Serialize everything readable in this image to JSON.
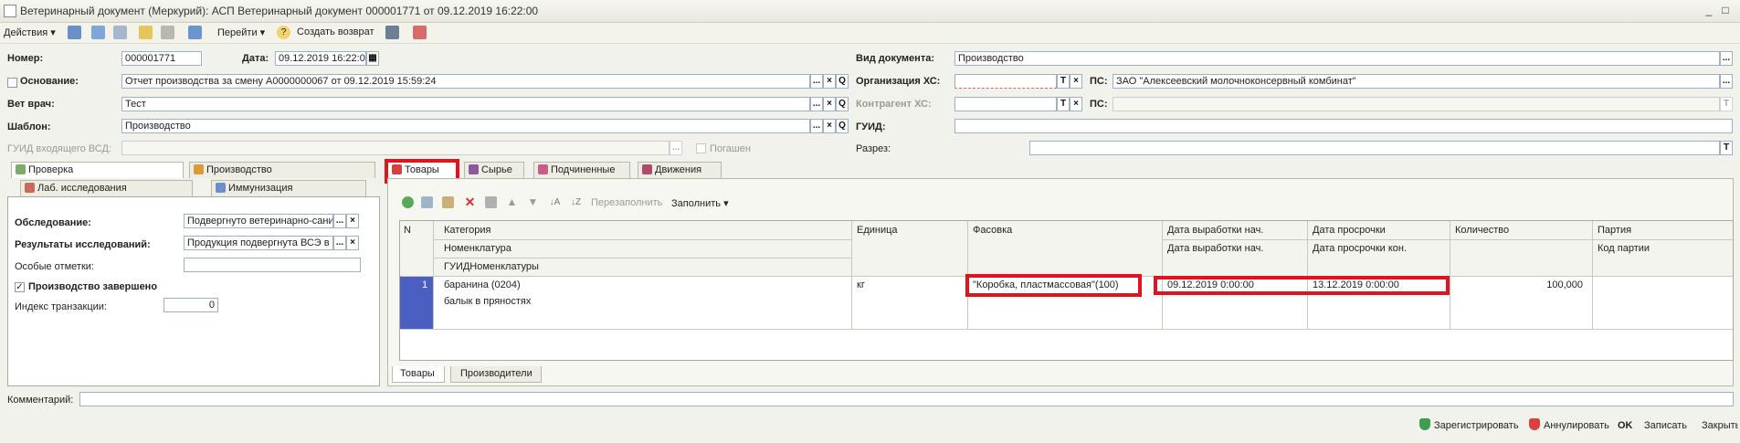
{
  "window": {
    "title": "Ветеринарный документ (Меркурий): АСП Ветеринарный документ 000001771 от 09.12.2019 16:22:00"
  },
  "toolbar": {
    "actions": "Действия",
    "go": "Перейти",
    "create_return": "Создать возврат"
  },
  "header": {
    "number_label": "Номер:",
    "number": "000001771",
    "date_label": "Дата:",
    "date": "09.12.2019 16:22:0",
    "basis_label": "Основание:",
    "basis": "Отчет производства за смену А0000000067 от 09.12.2019 15:59:24",
    "vet_label": "Вет врач:",
    "vet": "Тест",
    "template_label": "Шаблон:",
    "template": "Производство",
    "guid_in_label": "ГУИД входящего ВСД:",
    "repaid_label": "Погашен",
    "doctype_label": "Вид документа:",
    "doctype": "Производство",
    "org_label": "Организация ХС:",
    "org": "",
    "ps_label": "ПС:",
    "ps": "ЗАО \"Алексеевский молочноконсервный комбинат\"",
    "contractor_label": "Контрагент ХС:",
    "ps2_label": "ПС:",
    "guid_label": "ГУИД:",
    "cut_label": "Разрез:",
    "t_btn": "T",
    "x_btn": "×",
    "dots_btn": "...",
    "q_btn": "Q"
  },
  "left_tabs": {
    "check": "Проверка",
    "production": "Производство",
    "lab": "Лаб. исследования",
    "immun": "Иммунизация"
  },
  "left_panel": {
    "survey_label": "Обследование:",
    "survey": "Подвергнуто ветеринарно-сани",
    "results_label": "Результаты исследований:",
    "results": "Продукция подвергнута ВСЭ в г",
    "special_label": "Особые отметки:",
    "done_label": "Производство завершено",
    "index_label": "Индекс транзакции:",
    "index": "0"
  },
  "right_tabs": {
    "goods": "Товары",
    "raw": "Сырье",
    "subordinate": "Подчиненные",
    "moves": "Движения"
  },
  "grid_toolbar": {
    "refill": "Перезаполнить",
    "fill": "Заполнить"
  },
  "grid": {
    "headers": {
      "n": "N",
      "category": "Категория",
      "nomenclature": "Номенклатура",
      "guid_nom": "ГУИДНоменклатуры",
      "unit": "Единица",
      "packing": "Фасовка",
      "prod_start": "Дата выработки нач.",
      "prod_start2": "Дата выработки нач.",
      "exp": "Дата просрочки",
      "exp_end": "Дата просрочки кон.",
      "qty": "Количество",
      "batch": "Партия",
      "batch_code": "Код партии"
    },
    "row": {
      "n": "1",
      "category": "баранина (0204)",
      "nomenclature": "балык в пряностях",
      "unit": "кг",
      "packing": "\"Коробка, пластмассовая\"(100)",
      "prod_start": "09.12.2019 0:00:00",
      "exp": "13.12.2019 0:00:00",
      "qty": "100,000"
    }
  },
  "bottom_tabs": {
    "goods": "Товары",
    "producers": "Производители"
  },
  "comment_label": "Комментарий:",
  "footer": {
    "register": "Зарегистрировать",
    "annul": "Аннулировать",
    "ok": "OK",
    "save": "Записать",
    "close": "Закрыть"
  },
  "colors": {
    "highlight": "#e0141e",
    "row_selected": "#4a5fbf"
  }
}
